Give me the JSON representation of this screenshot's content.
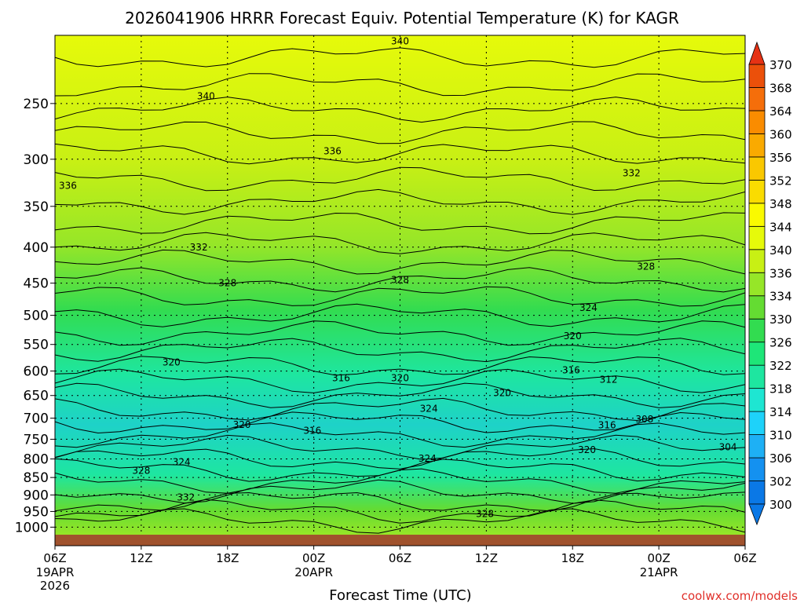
{
  "chart_data": {
    "type": "heatmap",
    "title": "2026041906 HRRR Forecast Equiv. Potential Temperature (K) for KAGR",
    "xlabel": "Forecast Time (UTC)",
    "ylabel": "",
    "x_ticks": [
      {
        "label": "06Z",
        "label2": "19APR",
        "label3": "2026",
        "hour": 0
      },
      {
        "label": "12Z",
        "label2": "",
        "label3": "",
        "hour": 6
      },
      {
        "label": "18Z",
        "label2": "",
        "label3": "",
        "hour": 12
      },
      {
        "label": "00Z",
        "label2": "20APR",
        "label3": "",
        "hour": 18
      },
      {
        "label": "06Z",
        "label2": "",
        "label3": "",
        "hour": 24
      },
      {
        "label": "12Z",
        "label2": "",
        "label3": "",
        "hour": 30
      },
      {
        "label": "18Z",
        "label2": "",
        "label3": "",
        "hour": 36
      },
      {
        "label": "00Z",
        "label2": "21APR",
        "label3": "",
        "hour": 42
      },
      {
        "label": "06Z",
        "label2": "",
        "label3": "",
        "hour": 48
      }
    ],
    "x_range_hours": [
      0,
      48
    ],
    "y_ticks": [
      250,
      300,
      350,
      400,
      450,
      500,
      550,
      600,
      650,
      700,
      750,
      800,
      850,
      900,
      950,
      1000
    ],
    "y_range_hpa": [
      200,
      1025
    ],
    "y_scale": "log-pressure",
    "grid": true,
    "colorbar": {
      "levels": [
        300,
        302,
        306,
        310,
        314,
        318,
        322,
        326,
        330,
        334,
        336,
        340,
        344,
        348,
        352,
        356,
        360,
        364,
        368,
        370
      ],
      "colors": [
        "#0a78e6",
        "#1491f0",
        "#1eb0f5",
        "#1ed2fa",
        "#1ee6d2",
        "#1ee6a0",
        "#1ee678",
        "#32dc50",
        "#64dc32",
        "#96e628",
        "#c8f014",
        "#e6fa0a",
        "#fafa00",
        "#fadc00",
        "#fac800",
        "#faaa00",
        "#fa8c00",
        "#f56e0a",
        "#eb500a",
        "#e63214"
      ]
    },
    "contour_labels": [
      {
        "value": "340",
        "hour": 24.0,
        "p": 204
      },
      {
        "value": "340",
        "hour": 10.5,
        "p": 244
      },
      {
        "value": "336",
        "hour": 19.3,
        "p": 292
      },
      {
        "value": "336",
        "hour": 0.9,
        "p": 327
      },
      {
        "value": "332",
        "hour": 40.1,
        "p": 314
      },
      {
        "value": "332",
        "hour": 10.0,
        "p": 400
      },
      {
        "value": "328",
        "hour": 12.0,
        "p": 450
      },
      {
        "value": "328",
        "hour": 24.0,
        "p": 445
      },
      {
        "value": "328",
        "hour": 41.1,
        "p": 426
      },
      {
        "value": "324",
        "hour": 37.1,
        "p": 488
      },
      {
        "value": "320",
        "hour": 36.0,
        "p": 535
      },
      {
        "value": "320",
        "hour": 8.1,
        "p": 583
      },
      {
        "value": "316",
        "hour": 19.9,
        "p": 614
      },
      {
        "value": "320",
        "hour": 24.0,
        "p": 614
      },
      {
        "value": "316",
        "hour": 35.9,
        "p": 598
      },
      {
        "value": "312",
        "hour": 38.5,
        "p": 617
      },
      {
        "value": "320",
        "hour": 31.1,
        "p": 645
      },
      {
        "value": "324",
        "hour": 26.0,
        "p": 679
      },
      {
        "value": "320",
        "hour": 13.0,
        "p": 715
      },
      {
        "value": "316",
        "hour": 17.9,
        "p": 729
      },
      {
        "value": "316",
        "hour": 38.4,
        "p": 716
      },
      {
        "value": "308",
        "hour": 41.0,
        "p": 703
      },
      {
        "value": "320",
        "hour": 37.0,
        "p": 777
      },
      {
        "value": "304",
        "hour": 46.8,
        "p": 770
      },
      {
        "value": "324",
        "hour": 8.8,
        "p": 808
      },
      {
        "value": "324",
        "hour": 25.9,
        "p": 799
      },
      {
        "value": "328",
        "hour": 6.0,
        "p": 831
      },
      {
        "value": "332",
        "hour": 9.1,
        "p": 907
      },
      {
        "value": "328",
        "hour": 29.9,
        "p": 957
      }
    ]
  },
  "credit": "coolwx.com/models"
}
